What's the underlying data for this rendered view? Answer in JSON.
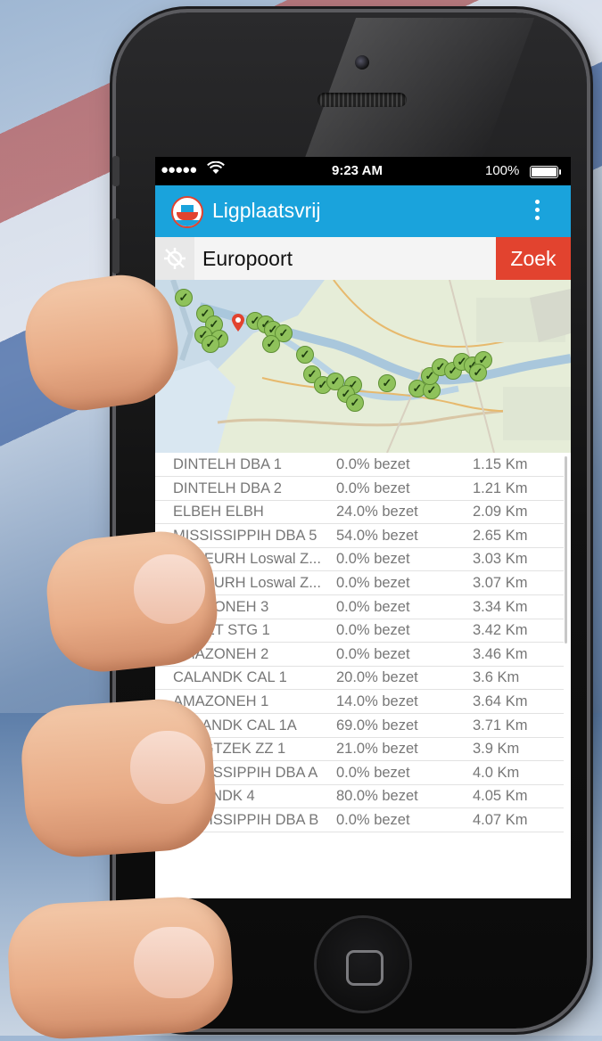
{
  "status_bar": {
    "carrier": "●●●●●",
    "time": "9:23 AM",
    "battery": "100%"
  },
  "app_bar": {
    "title": "Ligplaatsvrij",
    "logo_icon": "ship-icon",
    "menu_icon": "overflow-menu-icon",
    "color": "#1aa3dc"
  },
  "search": {
    "value": "Europoort",
    "button_label": "Zoek",
    "location_icon": "location-off-icon",
    "button_color": "#e2432f"
  },
  "map": {
    "marker_icon": "checkmark-icon",
    "marker_color": "#8fc25b",
    "pin_color": "#e2432f"
  },
  "berths": [
    {
      "name": "DINTELH  DBA 1",
      "occupancy": "0.0% bezet",
      "distance": "1.15 Km"
    },
    {
      "name": "DINTELH  DBA 2",
      "occupancy": "0.0% bezet",
      "distance": "1.21 Km"
    },
    {
      "name": "ELBEH  ELBH",
      "occupancy": "24.0% bezet",
      "distance": "2.09 Km"
    },
    {
      "name": "MISSISSIPPIH  DBA 5",
      "occupancy": "54.0% bezet",
      "distance": "2.65 Km"
    },
    {
      "name": "SCHEURH  Loswal Z...",
      "occupancy": "0.0% bezet",
      "distance": "3.03 Km"
    },
    {
      "name": "SCHEURH  Loswal Z...",
      "occupancy": "0.0% bezet",
      "distance": "3.07 Km"
    },
    {
      "name": "AMAZONEH  3",
      "occupancy": "0.0% bezet",
      "distance": "3.34 Km"
    },
    {
      "name": "4E PET  STG 1",
      "occupancy": "0.0% bezet",
      "distance": "3.42 Km"
    },
    {
      "name": "AMAZONEH  2",
      "occupancy": "0.0% bezet",
      "distance": "3.46 Km"
    },
    {
      "name": "CALANDK  CAL 1",
      "occupancy": "20.0% bezet",
      "distance": "3.6 Km"
    },
    {
      "name": "AMAZONEH  1",
      "occupancy": "14.0% bezet",
      "distance": "3.64 Km"
    },
    {
      "name": "CALANDK  CAL 1A",
      "occupancy": "69.0% bezet",
      "distance": "3.71 Km"
    },
    {
      "name": "YANGTZEK  ZZ 1",
      "occupancy": "21.0% bezet",
      "distance": "3.9 Km"
    },
    {
      "name": "MISSISSIPPIH  DBA A",
      "occupancy": "0.0% bezet",
      "distance": "4.0 Km"
    },
    {
      "name": "CALANDK  4",
      "occupancy": "80.0% bezet",
      "distance": "4.05 Km"
    },
    {
      "name": "MISSISSIPPIH  DBA B",
      "occupancy": "0.0% bezet",
      "distance": "4.07 Km"
    }
  ]
}
